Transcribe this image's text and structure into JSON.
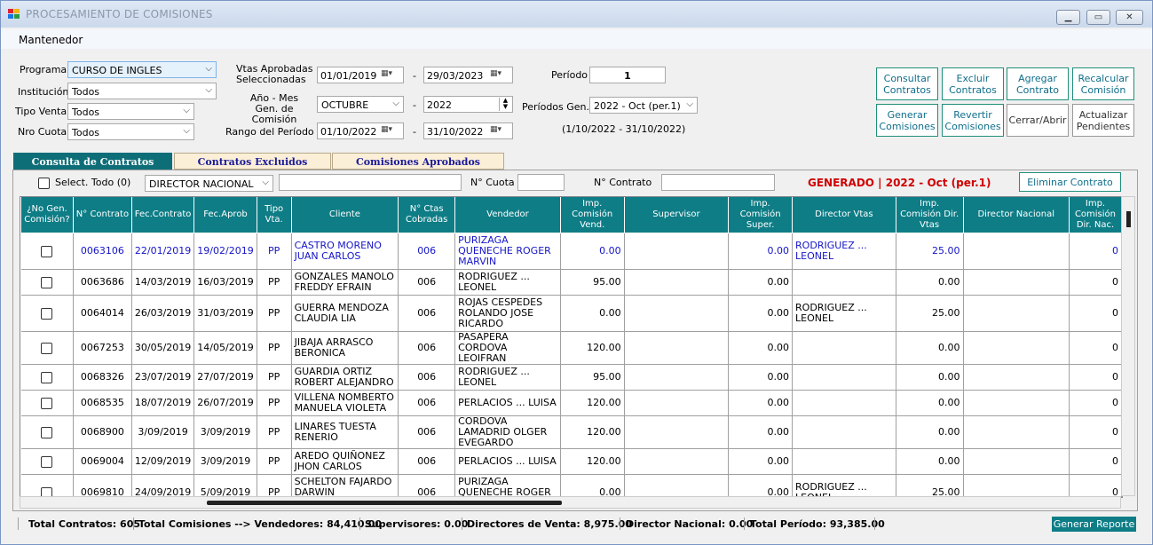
{
  "window": {
    "title": "PROCESAMIENTO DE COMISIONES"
  },
  "menu": {
    "mantenedor": "Mantenedor"
  },
  "filters": {
    "programa_label": "Programa",
    "programa_value": "CURSO DE INGLES",
    "institucion_label": "Institución",
    "institucion_value": "Todos",
    "tipo_venta_label": "Tipo Venta",
    "tipo_venta_value": "Todos",
    "nro_cuota_label": "Nro Cuota",
    "nro_cuota_value": "Todos",
    "vtas_label": "Vtas Aprobadas Seleccionadas",
    "vtas_from": "01/01/2019",
    "vtas_to": "29/03/2023",
    "anio_mes_label": "Año - Mes Gen. de Comisión",
    "mes_value": "OCTUBRE",
    "anio_value": "2022",
    "rango_label": "Rango del Período",
    "rango_from": "01/10/2022",
    "rango_to": "31/10/2022",
    "dash": "-",
    "periodo_label": "Período",
    "periodo_value": "1",
    "periodos_gen_label": "Períodos Gen.",
    "periodos_gen_value": "2022 - Oct (per.1)",
    "periodo_range": "(1/10/2022 - 31/10/2022)"
  },
  "actions": {
    "consultar": "Consultar Contratos",
    "excluir": "Excluir Contratos",
    "agregar": "Agregar Contrato",
    "recalcular": "Recalcular Comisión",
    "generar": "Generar Comisiones",
    "revertir": "Revertir Comisiones",
    "cerrar": "Cerrar/Abrir",
    "actualizar": "Actualizar Pendientes"
  },
  "tabs": [
    "Consulta de Contratos",
    "Contratos Excluidos",
    "Comisiones Aprobados"
  ],
  "toolbar": {
    "select_todo": "Select. Todo (0)",
    "director_value": "DIRECTOR NACIONAL",
    "cuota_label": "N° Cuota",
    "contrato_label": "N° Contrato",
    "generado": "GENERADO | 2022 - Oct (per.1)",
    "eliminar": "Eliminar Contrato"
  },
  "grid": {
    "columns": [
      "¿No Gen. Comisión?",
      "N° Contrato",
      "Fec.Contrato",
      "Fec.Aprob",
      "Tipo Vta.",
      "Cliente",
      "N° Ctas Cobradas",
      "Vendedor",
      "Imp. Comisión Vend.",
      "Supervisor",
      "Imp. Comisión Super.",
      "Director Vtas",
      "Imp. Comisión Dir. Vtas",
      "Director Nacional",
      "Imp. Comisión Dir. Nac."
    ],
    "rows": [
      {
        "contrato": "0063106",
        "fec_contrato": "22/01/2019",
        "fec_aprob": "19/02/2019",
        "tipo": "PP",
        "cliente": "CASTRO MORENO JUAN CARLOS",
        "ctas": "006",
        "vendedor": "PURIZAGA QUENECHE ROGER MARVIN",
        "imp_vend": "0.00",
        "supervisor": "",
        "imp_super": "0.00",
        "dir_vtas": "RODRIGUEZ ... LEONEL",
        "imp_dir": "25.00",
        "dir_nac": "",
        "imp_nac": "0",
        "highlight": true
      },
      {
        "contrato": "0063686",
        "fec_contrato": "14/03/2019",
        "fec_aprob": "16/03/2019",
        "tipo": "PP",
        "cliente": "GONZALES MANOLO FREDDY EFRAIN",
        "ctas": "006",
        "vendedor": "RODRIGUEZ ... LEONEL",
        "imp_vend": "95.00",
        "supervisor": "",
        "imp_super": "0.00",
        "dir_vtas": "",
        "imp_dir": "0.00",
        "dir_nac": "",
        "imp_nac": "0",
        "highlight": false
      },
      {
        "contrato": "0064014",
        "fec_contrato": "26/03/2019",
        "fec_aprob": "31/03/2019",
        "tipo": "PP",
        "cliente": "GUERRA MENDOZA CLAUDIA LIA",
        "ctas": "006",
        "vendedor": "ROJAS CESPEDES ROLANDO JOSE RICARDO",
        "imp_vend": "0.00",
        "supervisor": "",
        "imp_super": "0.00",
        "dir_vtas": "RODRIGUEZ ... LEONEL",
        "imp_dir": "25.00",
        "dir_nac": "",
        "imp_nac": "0",
        "highlight": false
      },
      {
        "contrato": "0067253",
        "fec_contrato": "30/05/2019",
        "fec_aprob": "14/05/2019",
        "tipo": "PP",
        "cliente": "JIBAJA ARRASCO BERONICA",
        "ctas": "006",
        "vendedor": "PASAPERA CORDOVA LEOIFRAN",
        "imp_vend": "120.00",
        "supervisor": "",
        "imp_super": "0.00",
        "dir_vtas": "",
        "imp_dir": "0.00",
        "dir_nac": "",
        "imp_nac": "0",
        "highlight": false
      },
      {
        "contrato": "0068326",
        "fec_contrato": "23/07/2019",
        "fec_aprob": "27/07/2019",
        "tipo": "PP",
        "cliente": "GUARDIA ORTIZ ROBERT ALEJANDRO",
        "ctas": "006",
        "vendedor": "RODRIGUEZ ... LEONEL",
        "imp_vend": "95.00",
        "supervisor": "",
        "imp_super": "0.00",
        "dir_vtas": "",
        "imp_dir": "0.00",
        "dir_nac": "",
        "imp_nac": "0",
        "highlight": false
      },
      {
        "contrato": "0068535",
        "fec_contrato": "18/07/2019",
        "fec_aprob": "26/07/2019",
        "tipo": "PP",
        "cliente": "VILLENA NOMBERTO MANUELA VIOLETA",
        "ctas": "006",
        "vendedor": "PERLACIOS ... LUISA",
        "imp_vend": "120.00",
        "supervisor": "",
        "imp_super": "0.00",
        "dir_vtas": "",
        "imp_dir": "0.00",
        "dir_nac": "",
        "imp_nac": "0",
        "highlight": false
      },
      {
        "contrato": "0068900",
        "fec_contrato": "3/09/2019",
        "fec_aprob": "3/09/2019",
        "tipo": "PP",
        "cliente": "LINARES TUESTA RENERIO",
        "ctas": "006",
        "vendedor": "CORDOVA LAMADRID OLGER EVEGARDO",
        "imp_vend": "120.00",
        "supervisor": "",
        "imp_super": "0.00",
        "dir_vtas": "",
        "imp_dir": "0.00",
        "dir_nac": "",
        "imp_nac": "0",
        "highlight": false
      },
      {
        "contrato": "0069004",
        "fec_contrato": "12/09/2019",
        "fec_aprob": "3/09/2019",
        "tipo": "PP",
        "cliente": "AREDO QUIÑONEZ JHON CARLOS",
        "ctas": "006",
        "vendedor": "PERLACIOS ... LUISA",
        "imp_vend": "120.00",
        "supervisor": "",
        "imp_super": "0.00",
        "dir_vtas": "",
        "imp_dir": "0.00",
        "dir_nac": "",
        "imp_nac": "0",
        "highlight": false
      },
      {
        "contrato": "0069810",
        "fec_contrato": "24/09/2019",
        "fec_aprob": "5/09/2019",
        "tipo": "PP",
        "cliente": "SCHELTON FAJARDO DARWIN ALEXANDER",
        "ctas": "006",
        "vendedor": "PURIZAGA QUENECHE ROGER MARVIN",
        "imp_vend": "0.00",
        "supervisor": "",
        "imp_super": "0.00",
        "dir_vtas": "RODRIGUEZ ... LEONEL",
        "imp_dir": "25.00",
        "dir_nac": "",
        "imp_nac": "0",
        "highlight": false
      }
    ]
  },
  "status": {
    "total_contratos": "Total Contratos: 605",
    "total_comisiones": "Total Comisiones --> Vendedores: 84,410.00",
    "supervisores": "Supervisores: 0.00",
    "directores": "Directores de Venta: 8,975.00",
    "director_nacional": "Director Nacional: 0.00",
    "total_periodo": "Total Período: 93,385.00",
    "generar_reporte": "Generar Reporte"
  }
}
